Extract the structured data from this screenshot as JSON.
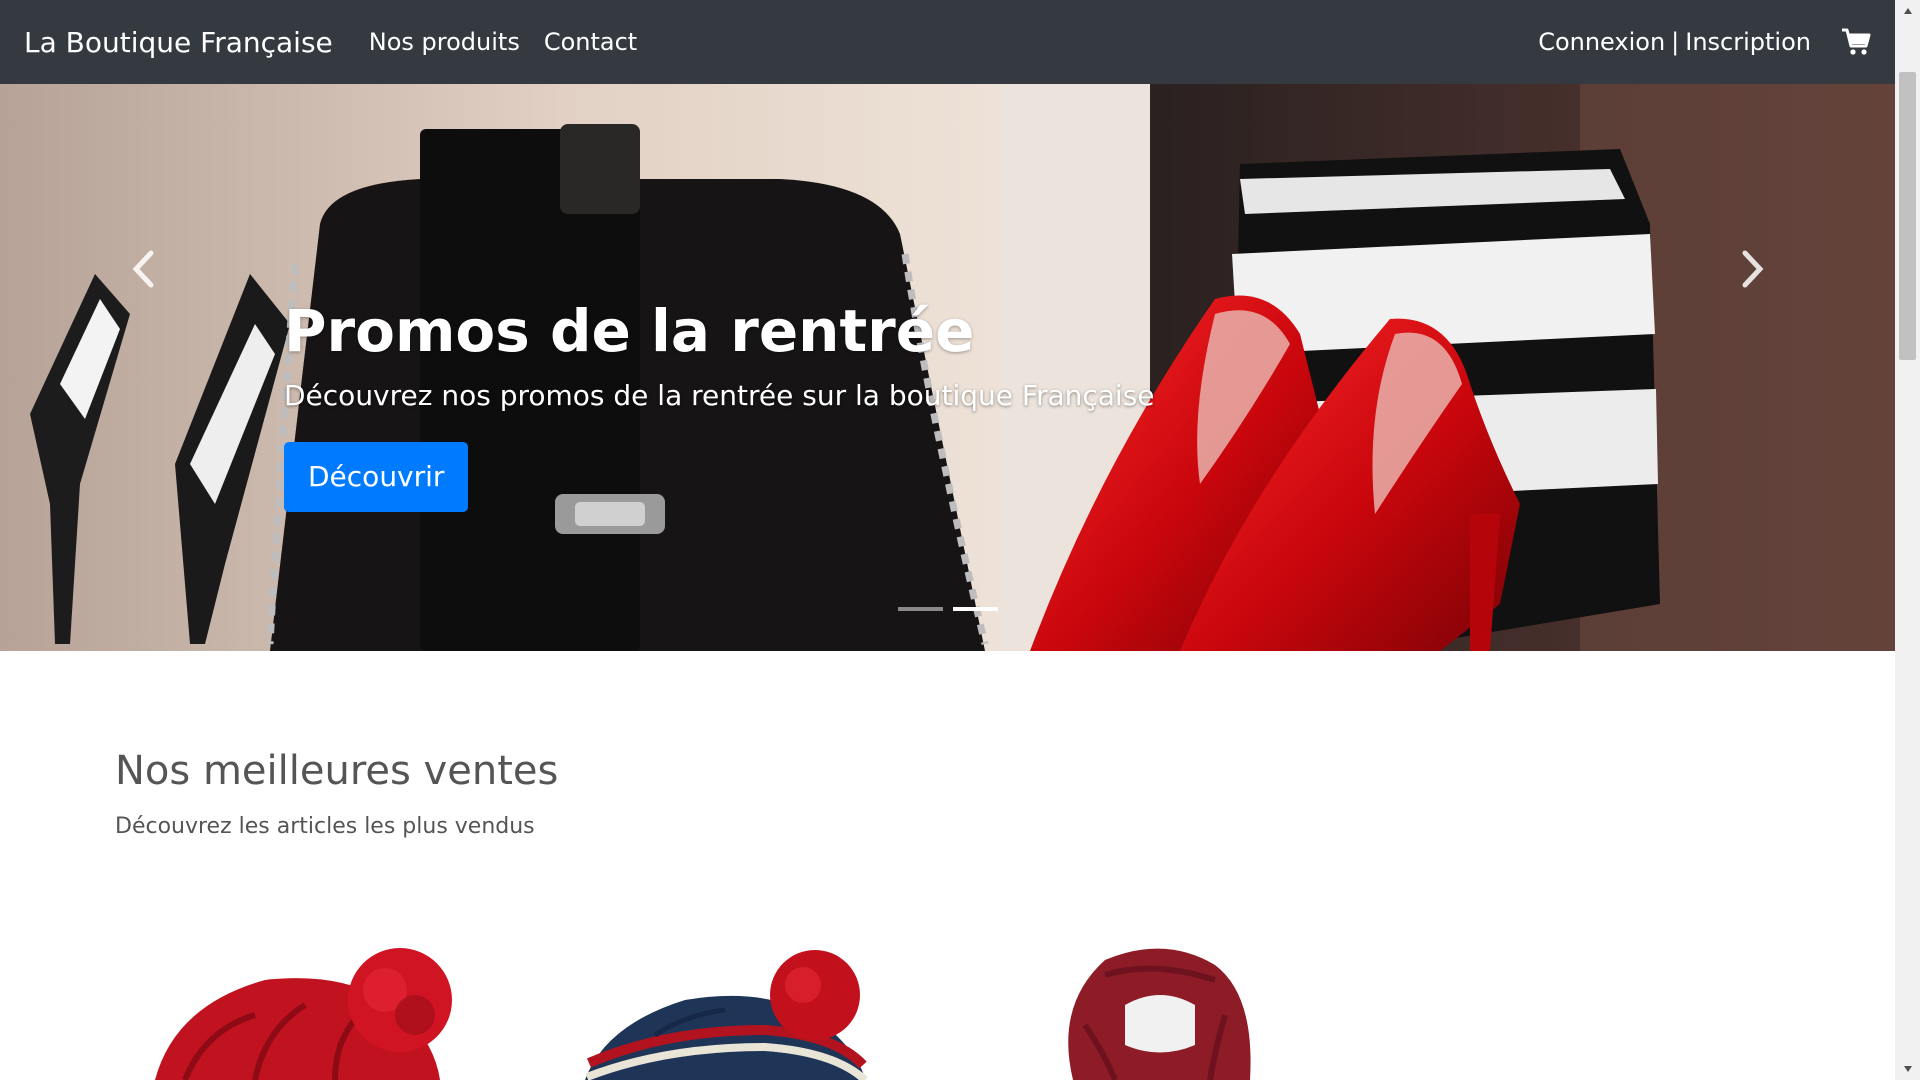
{
  "navbar": {
    "brand": "La Boutique Française",
    "links": [
      "Nos produits",
      "Contact"
    ],
    "login": "Connexion",
    "separator": "|",
    "register": "Inscription",
    "cart_icon": "shopping-cart-icon"
  },
  "carousel": {
    "title": "Promos de la rentrée",
    "subtitle": "Découvrez nos promos de la rentrée sur la boutique Française",
    "button": "Découvrir",
    "prev_icon": "chevron-left-icon",
    "next_icon": "chevron-right-icon",
    "slide_count": 2,
    "active_slide": 2
  },
  "best_sellers": {
    "title": "Nos meilleures ventes",
    "subtitle": "Découvrez les articles les plus vendus",
    "products": [
      {
        "image": "red-knit-beanie-image"
      },
      {
        "image": "navy-striped-beanie-image"
      },
      {
        "image": "burgundy-scarf-image"
      }
    ]
  },
  "colors": {
    "navbar": "#343a40",
    "primary": "#007bff",
    "text_muted": "#555555"
  }
}
